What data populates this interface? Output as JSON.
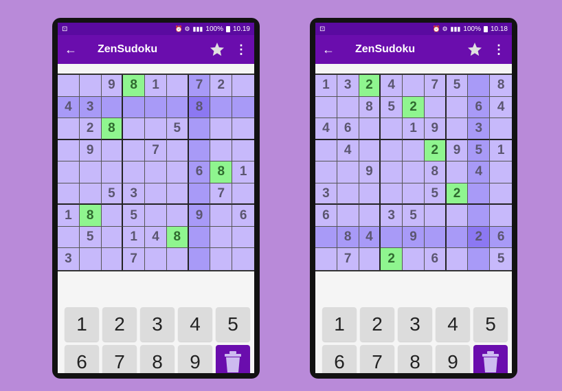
{
  "colors": {
    "background": "#b98ad9",
    "appbar": "#6a0dad",
    "statusbar": "#5a0aa0",
    "cell": "#c7b9fb",
    "highlight": "#a89af7",
    "selected": "#8c78f2",
    "match": "#8ff58f"
  },
  "screens": [
    {
      "status": {
        "left_glyph": "⊡",
        "icons": "⏰ ⚙",
        "signal": "📶",
        "battery_pct": "100%",
        "time": "10.19"
      },
      "app": {
        "title": "ZenSudoku",
        "back_icon": "arrow-back-icon",
        "star_icon": "star-icon",
        "menu_icon": "more-vert-icon"
      },
      "grid": [
        [
          "",
          "",
          "9",
          "8",
          "1",
          "",
          "7",
          "2",
          ""
        ],
        [
          "4",
          "3",
          "",
          "",
          "",
          "",
          "8",
          "",
          ""
        ],
        [
          "",
          "2",
          "8",
          "",
          "",
          "5",
          "",
          "",
          ""
        ],
        [
          "",
          "9",
          "",
          "",
          "7",
          "",
          "",
          "",
          ""
        ],
        [
          "",
          "",
          "",
          "",
          "",
          "",
          "6",
          "8",
          "1"
        ],
        [
          "",
          "",
          "5",
          "3",
          "",
          "",
          "",
          "7",
          ""
        ],
        [
          "1",
          "8",
          "",
          "5",
          "",
          "",
          "9",
          "",
          "6"
        ],
        [
          "",
          "5",
          "",
          "1",
          "4",
          "8",
          "",
          "",
          ""
        ],
        [
          "3",
          "",
          "",
          "7",
          "",
          "",
          "",
          "",
          ""
        ]
      ],
      "keypad": [
        "1",
        "2",
        "3",
        "4",
        "5",
        "6",
        "7",
        "8",
        "9"
      ],
      "delete_icon": "trash-icon"
    },
    {
      "status": {
        "left_glyph": "⊡",
        "icons": "⏰ ⚙",
        "signal": "📶",
        "battery_pct": "100%",
        "time": "10.18"
      },
      "app": {
        "title": "ZenSudoku",
        "back_icon": "arrow-back-icon",
        "star_icon": "star-icon",
        "menu_icon": "more-vert-icon"
      },
      "grid": [
        [
          "1",
          "3",
          "2",
          "4",
          "",
          "7",
          "5",
          "",
          "8"
        ],
        [
          "",
          "",
          "8",
          "5",
          "2",
          "",
          "",
          "6",
          "4"
        ],
        [
          "4",
          "6",
          "",
          "",
          "1",
          "9",
          "",
          "3",
          ""
        ],
        [
          "",
          "4",
          "",
          "",
          "",
          "2",
          "9",
          "5",
          "1"
        ],
        [
          "",
          "",
          "9",
          "",
          "",
          "8",
          "",
          "4",
          ""
        ],
        [
          "3",
          "",
          "",
          "",
          "",
          "5",
          "2",
          "",
          ""
        ],
        [
          "6",
          "",
          "",
          "3",
          "5",
          "",
          "",
          "",
          ""
        ],
        [
          "",
          "8",
          "4",
          "",
          "9",
          "",
          "",
          "2",
          "6"
        ],
        [
          "",
          "7",
          "",
          "2",
          "",
          "6",
          "",
          "",
          "5"
        ]
      ],
      "keypad": [
        "1",
        "2",
        "3",
        "4",
        "5",
        "6",
        "7",
        "8",
        "9"
      ],
      "delete_icon": "trash-icon"
    }
  ]
}
